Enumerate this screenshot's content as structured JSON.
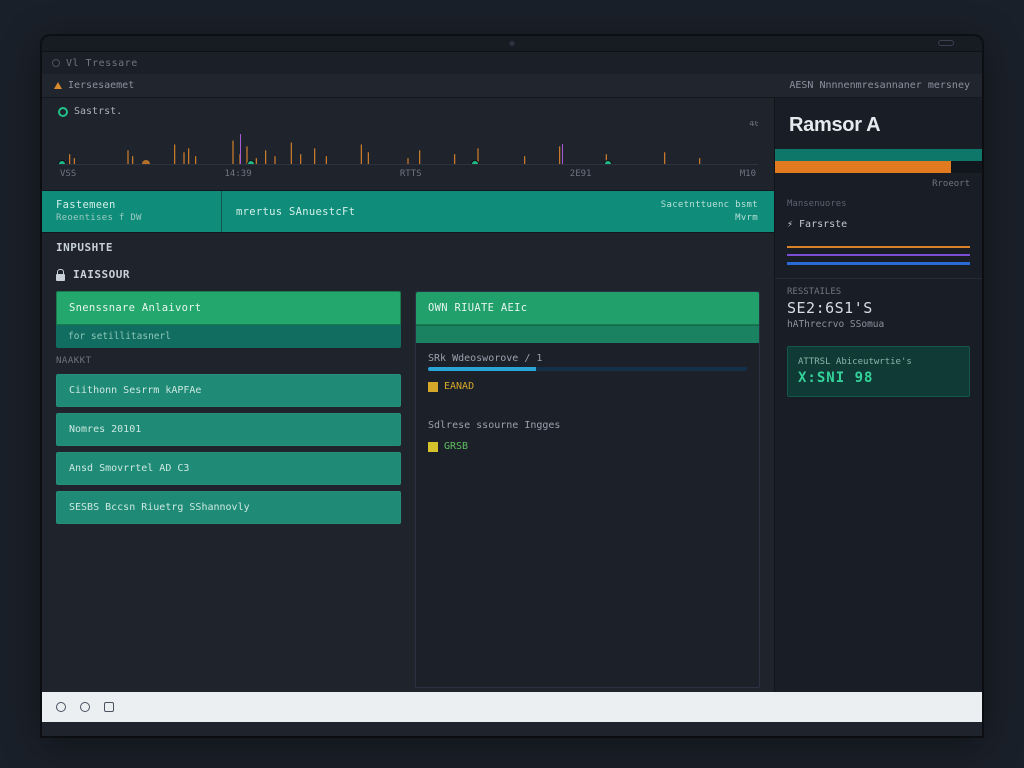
{
  "browser_tab": "Vl  Tressare",
  "header": {
    "left_label": "Iersesaemet",
    "right_label": "AESN Nnnnenmresannaner mersney"
  },
  "graph": {
    "legend": "Sastrst.",
    "axis": [
      "VSS",
      "14:39",
      "RTTS",
      "2E91",
      "M10"
    ],
    "y_label": "40"
  },
  "banners": {
    "left_title": "Fastemeen",
    "left_sub": "Reoentises f  DW",
    "mid_title": "mrertus  SAnuestcFt",
    "mid_right_1": "Sacetnttuenc  bsmt",
    "mid_right_2": "Mvrm"
  },
  "section": {
    "meta": "INPUSHTE",
    "title": "IAISSOUR"
  },
  "left_panel": {
    "header": "Snenssnare  Anlaivort",
    "sub": "for setillitasnerl",
    "label": "NAAKKT",
    "items": [
      "Ciithonn Sesrrm kAPFAe",
      "Nomres  20101",
      "Ansd  Smovrrtel AD C3",
      "SESBS Bccsn Riuetrg SShannovly"
    ]
  },
  "right_panel": {
    "header": "OWN RIUATE AEIc",
    "field1_label": "SRk Wdeosworove / 1",
    "field1_value": "EANAD",
    "field2_label": "Sdlrese ssourne Ingges",
    "field2_value": "GRSB"
  },
  "sidebar": {
    "title": "Ramsor A",
    "meta_top": "Rroeort",
    "meta_small": "Mansenuores",
    "sub_title": "Farsrste",
    "stat1_label": "RESSTAILES",
    "stat1_value": "SE2:6S1'S",
    "stat1_sub": "hAThrecrvo SSomua",
    "stat2_label": "ATTRSL Abiceutwrtie's",
    "stat2_value": "X:SNI 98"
  }
}
